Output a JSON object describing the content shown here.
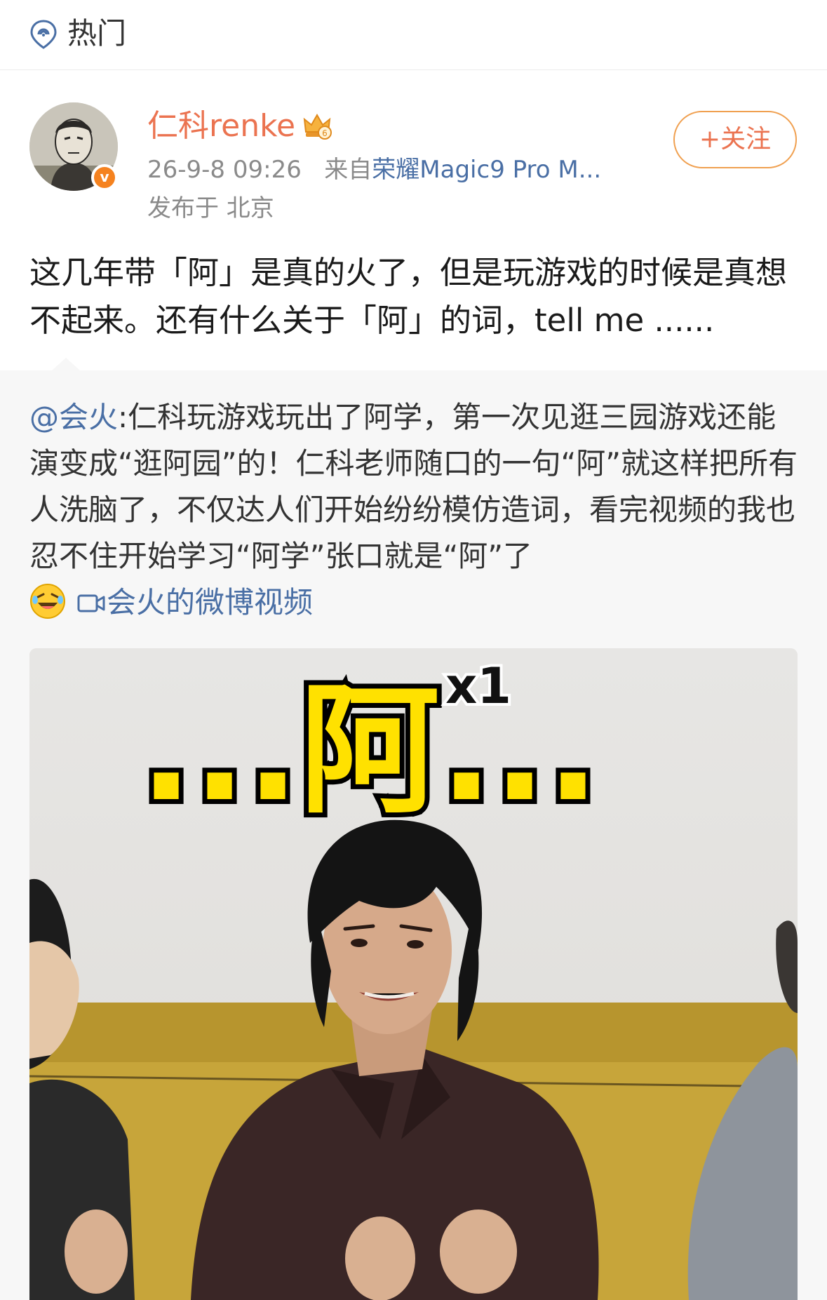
{
  "topbar": {
    "title": "热门",
    "icon": "hot-icon"
  },
  "post": {
    "author": {
      "name": "仁科renke",
      "badge": "v"
    },
    "timestamp": "26-9-8 09:26",
    "source_prefix": "来自",
    "source_device": "荣耀Magic9 Pro M...",
    "location": "发布于 北京",
    "follow_label": "+关注",
    "text": "这几年带「阿」是真的火了，但是玩游戏的时候是真想不起来。还有什么关于「阿」的词，tell me ......"
  },
  "repost": {
    "mention": "@会火",
    "text": ":仁科玩游戏玩出了阿学，第一次见逛三园游戏还能演变成“逛阿园”的！仁科老师随口的一句“阿”就这样把所有人洗脑了，不仅达人们开始纷纷模仿造词，看完视频的我也忍不住开始学习“阿学”张口就是“阿”了",
    "video_link": "会火的微博视频"
  },
  "video_overlay": {
    "caption": "...阿...",
    "counter": "x1"
  },
  "colors": {
    "link": "#4a6fa5",
    "accent": "#eb7350",
    "caption": "#ffe100"
  }
}
